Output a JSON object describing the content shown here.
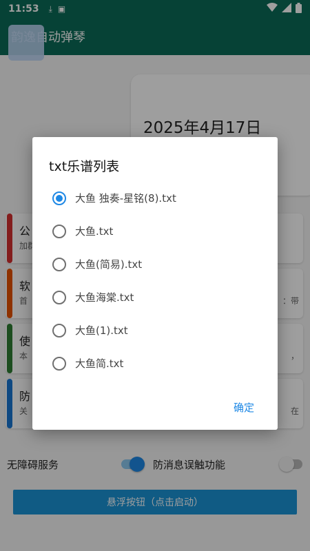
{
  "status_bar": {
    "time": "11:53"
  },
  "app_bar": {
    "title": "韵逸自动弹琴"
  },
  "date_card": {
    "date": "2025年4月17日"
  },
  "cards": [
    {
      "title": "公",
      "subtitle": "加群",
      "right": "",
      "color": "#d32f2f"
    },
    {
      "title": "软",
      "subtitle": "首",
      "right": "：带",
      "color": "#e65100"
    },
    {
      "title": "使",
      "subtitle": "本",
      "right": "，",
      "color": "#2e7d32"
    },
    {
      "title": "防",
      "subtitle": "关",
      "right": "在",
      "color": "#1976d2"
    }
  ],
  "switches": {
    "accessibility": {
      "label": "无障碍服务",
      "on": true
    },
    "anti_mistouch": {
      "label": "防消息误触功能",
      "on": false
    }
  },
  "float_button": {
    "label": "悬浮按钮（点击启动）"
  },
  "dialog": {
    "title": "txt乐谱列表",
    "options": [
      {
        "label": "大鱼 独奏-星铭(8).txt",
        "checked": true
      },
      {
        "label": "大鱼.txt",
        "checked": false
      },
      {
        "label": "大鱼(简易).txt",
        "checked": false
      },
      {
        "label": "大鱼海棠.txt",
        "checked": false
      },
      {
        "label": "大鱼(1).txt",
        "checked": false
      },
      {
        "label": "大鱼简.txt",
        "checked": false
      }
    ],
    "confirm_label": "确定"
  },
  "colors": {
    "primary": "#0b6b57",
    "accent": "#1e88e5",
    "button": "#1a93d6"
  }
}
